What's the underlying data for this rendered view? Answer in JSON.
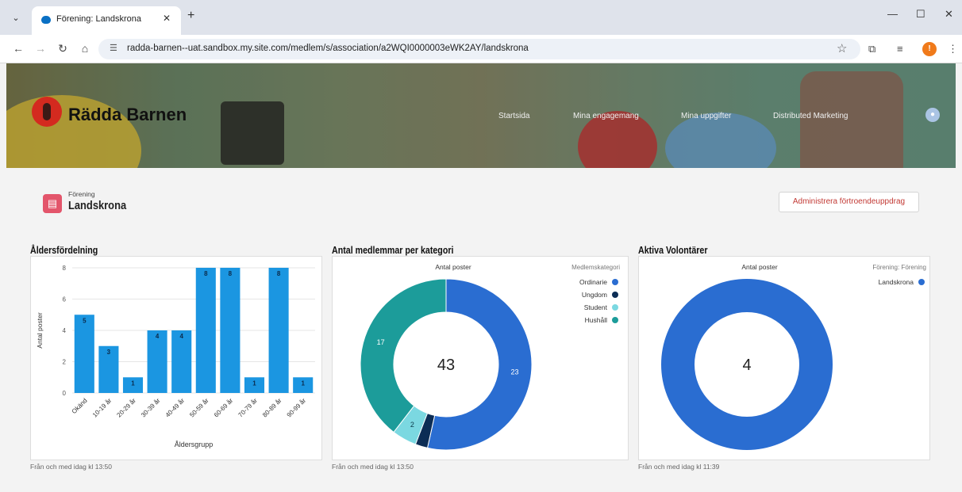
{
  "browser": {
    "tab_title": "Förening: Landskrona",
    "url": "radda-barnen--uat.sandbox.my.site.com/medlem/s/association/a2WQI0000003eWK2AY/landskrona",
    "profile_initial": "!"
  },
  "site": {
    "logo_text": "Rädda Barnen",
    "nav": [
      "Startsida",
      "Mina engagemang",
      "Mina uppgifter",
      "Distributed Marketing"
    ]
  },
  "association": {
    "type_label": "Förening",
    "name": "Landskrona",
    "admin_button": "Administrera förtroendeuppdrag"
  },
  "cards": [
    {
      "title": "Åldersfördelning",
      "footer": "Från och med idag kl 13:50"
    },
    {
      "title": "Antal medlemmar per kategori",
      "footer": "Från och med idag kl 13:50"
    },
    {
      "title": "Aktiva Volontärer",
      "footer": "Från och med idag kl 11:39"
    }
  ],
  "chart_data": [
    {
      "type": "bar",
      "title": "",
      "xlabel": "Åldersgrupp",
      "ylabel": "Antal poster",
      "categories": [
        "Okänd",
        "10-19 år",
        "20-29 år",
        "30-39 år",
        "40-49 år",
        "50-59 år",
        "60-69 år",
        "70-79 år",
        "80-89 år",
        "90-99 år"
      ],
      "values": [
        5,
        3,
        1,
        4,
        4,
        8,
        8,
        1,
        8,
        1
      ],
      "ylim": [
        0,
        8
      ],
      "yticks": [
        0,
        2,
        4,
        6,
        8
      ],
      "grid": true,
      "color": "#1b96e1"
    },
    {
      "type": "pie",
      "donut": true,
      "header": "Antal poster",
      "legend_title": "Medlemskategori",
      "legend_position": "top-right",
      "center_value": "43",
      "slices": [
        {
          "name": "Ordinarie",
          "value": 23,
          "color": "#2a6dd1"
        },
        {
          "name": "Ungdom",
          "value": 1,
          "color": "#0c2d55"
        },
        {
          "name": "Student",
          "value": 2,
          "color": "#7bd8e1"
        },
        {
          "name": "Hushåll",
          "value": 17,
          "color": "#1c9c9a"
        }
      ]
    },
    {
      "type": "pie",
      "donut": true,
      "header": "Antal poster",
      "legend_title": "Förening: Förening",
      "legend_position": "top-right",
      "center_value": "4",
      "slices": [
        {
          "name": "Landskrona",
          "value": 4,
          "color": "#2a6dd1"
        }
      ]
    }
  ]
}
